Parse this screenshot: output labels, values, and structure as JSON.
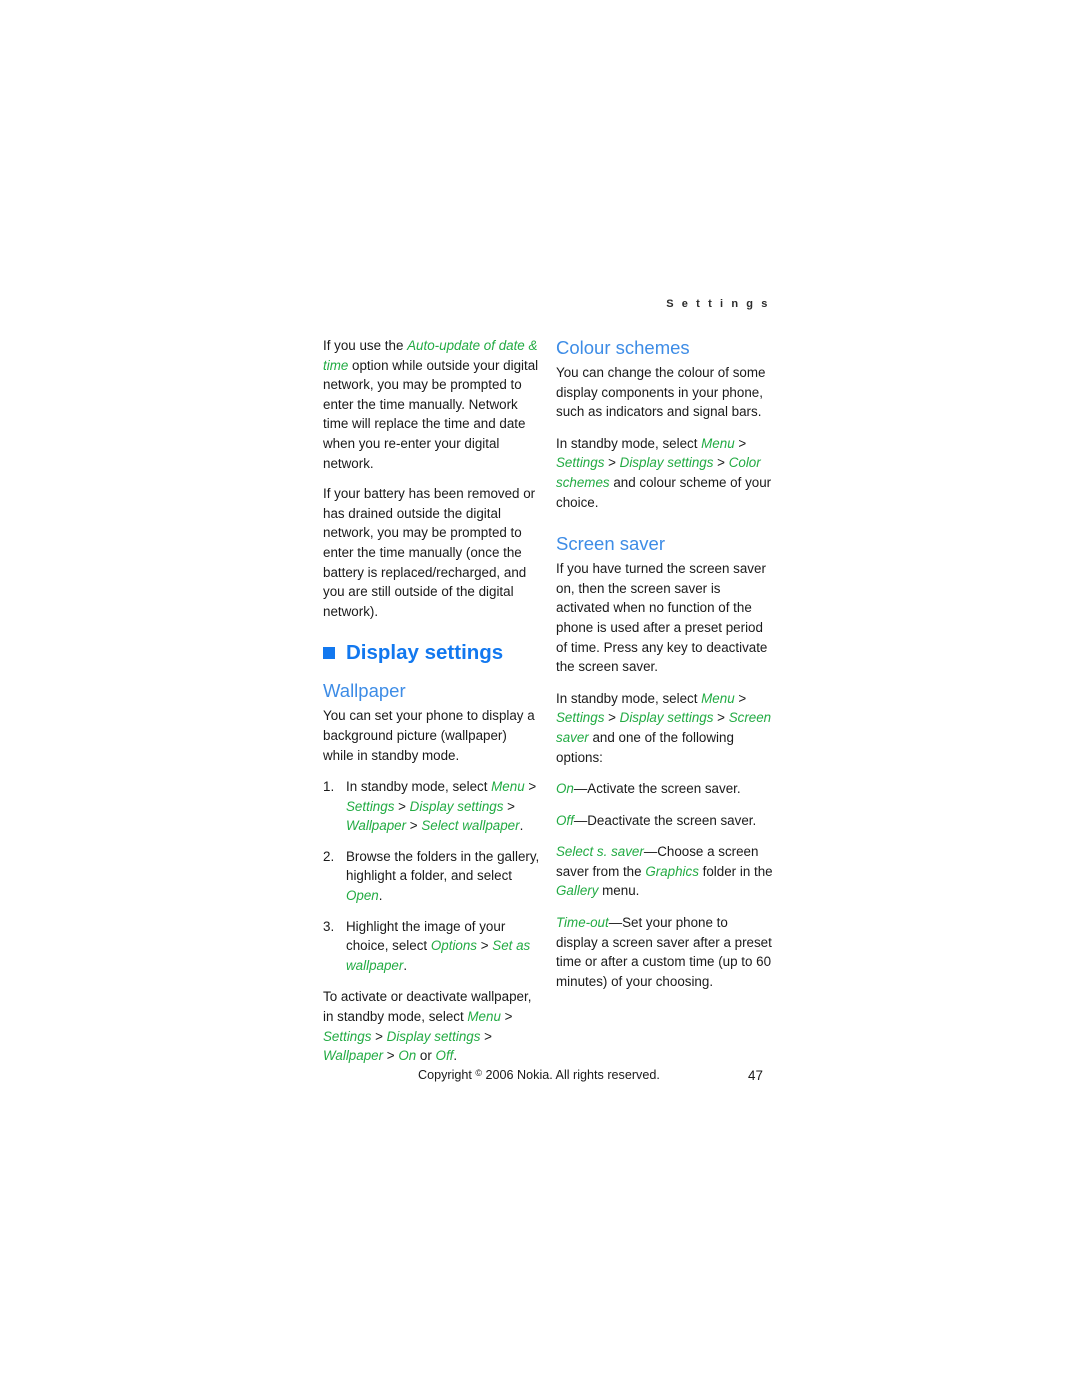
{
  "document": {
    "running_header": "S e t t i n g s",
    "colors": {
      "section_heading_blue": "#1278ef",
      "sub_heading_blue": "#3d8ce6",
      "menu_path_green": "#22ab43",
      "body_text": "#1a1a1a",
      "page_background": "#ffffff"
    }
  },
  "left_column": {
    "para_auto_update": {
      "seg1": "If you use the ",
      "menu1": "Auto-update of date & time",
      "seg2": " option while outside your digital network, you may be prompted to enter the time manually. Network time will replace the time and date when you re-enter your digital network."
    },
    "para_battery": "If your battery has been removed or has drained outside the digital network, you may be prompted to enter the time manually (once the battery is replaced/recharged, and you are still outside of the digital network).",
    "section_heading": "Display settings",
    "wallpaper": {
      "heading": "Wallpaper",
      "intro": "You can set your phone to display a background picture (wallpaper) while in standby mode.",
      "steps": [
        {
          "num": "1.",
          "seg1": "In standby mode, select ",
          "menu1": "Menu",
          "sep1": " > ",
          "menu2": "Settings",
          "sep2": " > ",
          "menu3": "Display settings",
          "sep3": " > ",
          "menu4": "Wallpaper",
          "sep4": " > ",
          "menu5": "Select wallpaper",
          "tail": "."
        },
        {
          "num": "2.",
          "seg1": "Browse the folders in the gallery, highlight a folder, and select ",
          "menu1": "Open",
          "tail": "."
        },
        {
          "num": "3.",
          "seg1": "Highlight the image of your choice, select ",
          "menu1": "Options",
          "sep1": " > ",
          "menu2": "Set as wallpaper",
          "tail": "."
        }
      ],
      "toggle_para": {
        "seg1": "To activate or deactivate wallpaper, in standby mode, select ",
        "menu1": "Menu",
        "sep1": " > ",
        "menu2": "Settings",
        "sep2": " > ",
        "menu3": "Display settings",
        "sep3": " > ",
        "menu4": "Wallpaper",
        "sep4": " > ",
        "menu5": "On",
        "seg2": " or ",
        "menu6": "Off",
        "tail": "."
      }
    }
  },
  "right_column": {
    "colour_schemes": {
      "heading": "Colour schemes",
      "intro": "You can change the colour of some display components in your phone, such as indicators and signal bars.",
      "path_para": {
        "seg1": "In standby mode, select ",
        "menu1": "Menu",
        "sep1": " > ",
        "menu2": "Settings",
        "sep2": " > ",
        "menu3": "Display settings",
        "sep3": " > ",
        "menu4": "Color schemes",
        "seg2": " and colour scheme of your choice."
      }
    },
    "screen_saver": {
      "heading": "Screen saver",
      "intro": "If you have turned the screen saver on, then the screen saver is activated when no function of the phone is used after a preset period of time. Press any key to deactivate the screen saver.",
      "path_para": {
        "seg1": "In standby mode, select ",
        "menu1": "Menu",
        "sep1": " > ",
        "menu2": "Settings",
        "sep2": " > ",
        "menu3": "Display settings",
        "sep3": " > ",
        "menu4": "Screen saver",
        "seg2": " and one of the following options:"
      },
      "options": [
        {
          "term": "On",
          "dash": "—",
          "desc": "Activate the screen saver."
        },
        {
          "term": "Off",
          "dash": "—",
          "desc": "Deactivate the screen saver."
        },
        {
          "term": "Select s. saver",
          "dash": "—",
          "desc_seg1": "Choose a screen saver from the ",
          "menu1": "Graphics",
          "desc_seg2": " folder in the ",
          "menu2": "Gallery",
          "desc_seg3": " menu."
        },
        {
          "term": "Time-out",
          "dash": "—",
          "desc": "Set your phone to display a screen saver after a preset time or after a custom time (up to 60 minutes) of your choosing."
        }
      ]
    }
  },
  "footer": {
    "copyright_prefix": "Copyright ",
    "registered_mark": "©",
    "copyright_suffix": " 2006 Nokia. All rights reserved.",
    "page_number": "47"
  }
}
